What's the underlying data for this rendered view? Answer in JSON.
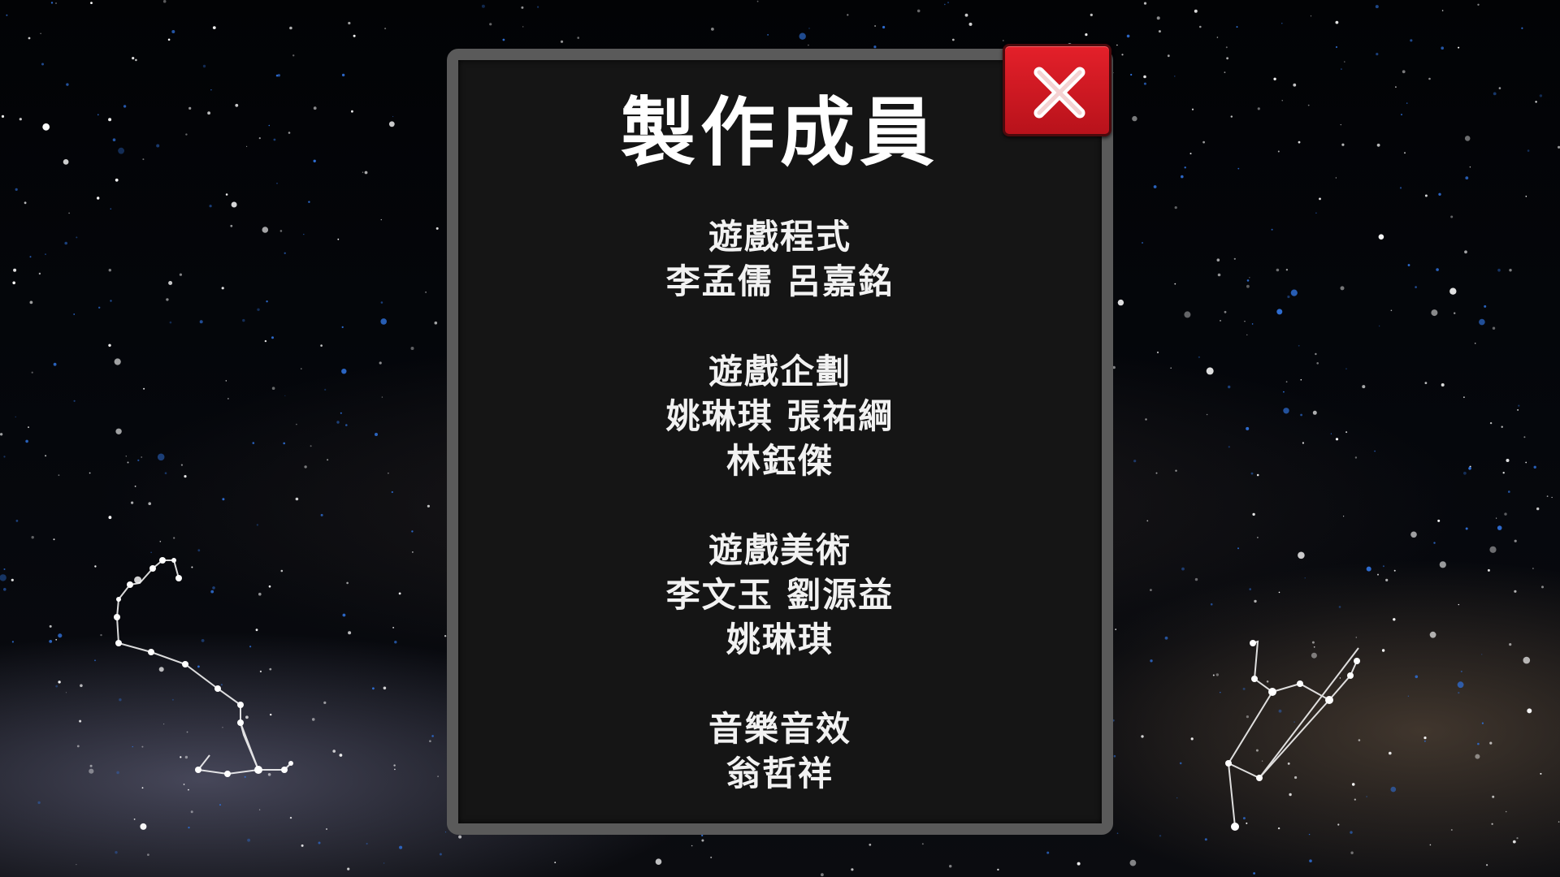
{
  "panel": {
    "title": "製作成員",
    "sections": [
      {
        "role": "遊戲程式",
        "names": [
          "李孟儒 呂嘉銘"
        ]
      },
      {
        "role": "遊戲企劃",
        "names": [
          "姚琳琪 張祐綱",
          "林鈺傑"
        ]
      },
      {
        "role": "遊戲美術",
        "names": [
          "李文玉 劉源益",
          "姚琳琪"
        ]
      },
      {
        "role": "音樂音效",
        "names": [
          "翁哲祥"
        ]
      }
    ]
  },
  "close_button": {
    "icon": "close-icon",
    "color": "#d7141e"
  },
  "background": {
    "description_icon": "starry-sky-with-constellations"
  }
}
